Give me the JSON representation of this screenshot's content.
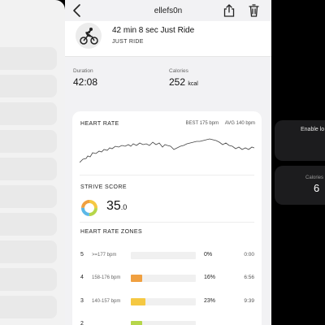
{
  "nav": {
    "title": "ellefs0n"
  },
  "activity": {
    "name": "42 min 8 sec Just Ride",
    "type": "JUST RIDE",
    "icon": "cyclist-icon"
  },
  "stats": [
    {
      "label": "Duration",
      "value": "42:08",
      "unit": ""
    },
    {
      "label": "Calories",
      "value": "252",
      "unit": "kcal"
    }
  ],
  "heart_rate": {
    "title": "HEART RATE",
    "best": "BEST 175 bpm",
    "avg": "AVG 140 bpm"
  },
  "strive": {
    "title": "STRIVE SCORE",
    "value": "35",
    "decimal": ".0"
  },
  "zones": {
    "title": "HEART RATE ZONES",
    "rows": [
      {
        "zone": "5",
        "range": ">=177 bpm",
        "percent": "0%",
        "pct_value": 0,
        "time": "0:00",
        "color": "#e8583a"
      },
      {
        "zone": "4",
        "range": "158-176 bpm",
        "percent": "16%",
        "pct_value": 16,
        "time": "6:56",
        "color": "#f0a040"
      },
      {
        "zone": "3",
        "range": "140-157 bpm",
        "percent": "23%",
        "pct_value": 23,
        "time": "9:39",
        "color": "#f5c842"
      },
      {
        "zone": "2",
        "range": "",
        "percent": "",
        "pct_value": 12,
        "time": "",
        "color": "#b6d64a"
      }
    ]
  },
  "right_cards": [
    {
      "label": "Enable lo",
      "value": ""
    },
    {
      "label": "Calories",
      "value": "6"
    }
  ]
}
